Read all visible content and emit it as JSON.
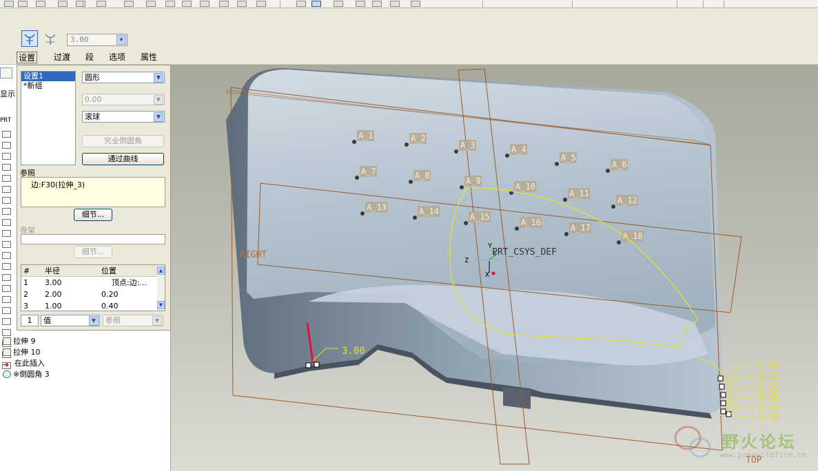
{
  "toolbar": {
    "icons": [
      "new-icon",
      "open-icon",
      "save-icon",
      "print-icon",
      "mail-icon",
      "undo-icon",
      "redo-icon",
      "cut-icon",
      "copy-icon",
      "paste-icon",
      "regenerate-icon",
      "repaint-icon",
      "zoom-icon",
      "orient-icon",
      "view-icon",
      "layer-icon",
      "plane-display-icon",
      "axis-display-icon",
      "point-display-icon",
      "csys-display-icon",
      "info-icon"
    ]
  },
  "dashboard": {
    "radius_value": "3.00",
    "tabs": [
      "设置",
      "过渡",
      "段",
      "选项",
      "属性"
    ],
    "active_tab": "设置"
  },
  "panel": {
    "sets": [
      "设置1",
      "*新组"
    ],
    "shape_combo": "圆形",
    "value_combo": "0.00",
    "method_combo": "滚球",
    "full_round_button": "完全倒圆角",
    "through_curve_button": "通过曲线",
    "reference_label": "参照",
    "reference_value": "边:F30(拉伸_3)",
    "details_button": "细节...",
    "skeleton_label": "骨架",
    "skeleton_details_button": "细节...",
    "table": {
      "headers": [
        "#",
        "半径",
        "位置"
      ],
      "rows": [
        {
          "index": "1",
          "radius": "3.00",
          "position": "顶点:边:..."
        },
        {
          "index": "2",
          "radius": "2.00",
          "position": "0.20"
        },
        {
          "index": "3",
          "radius": "1.00",
          "position": "0.40"
        }
      ]
    },
    "footer_index": "1",
    "footer_value_combo": "值",
    "footer_ref_combo": "参照"
  },
  "tree": {
    "partial_tab_label": "显示",
    "prt_label": "PRT",
    "items": [
      {
        "label": "拉伸 9",
        "icon": "extrude-icon"
      },
      {
        "label": "拉伸 10",
        "icon": "extrude-icon"
      },
      {
        "label": "在此插入",
        "icon": "insert-here-arrow-icon"
      },
      {
        "label": "※倒圆角 3",
        "icon": "round-icon"
      }
    ]
  },
  "viewport": {
    "datum_planes": [
      "RIGHT",
      "TOP"
    ],
    "csys_label": "PRT_CSYS_DEF",
    "axis_labels": [
      "Y",
      "Z",
      "X"
    ],
    "annotations": [
      "A_1",
      "A_2",
      "A_3",
      "A_4",
      "A_5",
      "A_6",
      "A_7",
      "A_8",
      "A_9",
      "A_10",
      "A_11",
      "A_12",
      "A_13",
      "A_14",
      "A_15",
      "A_16",
      "A_17",
      "A_18"
    ],
    "radius_dims_left": [
      "3.00"
    ],
    "radius_dims_right": [
      "2.00",
      "1.00",
      "1.00",
      "0.20",
      "0.40",
      "0.60",
      "0.80"
    ],
    "watermark": {
      "title": "野火论坛",
      "url": "www.proewildfire.cn"
    }
  }
}
